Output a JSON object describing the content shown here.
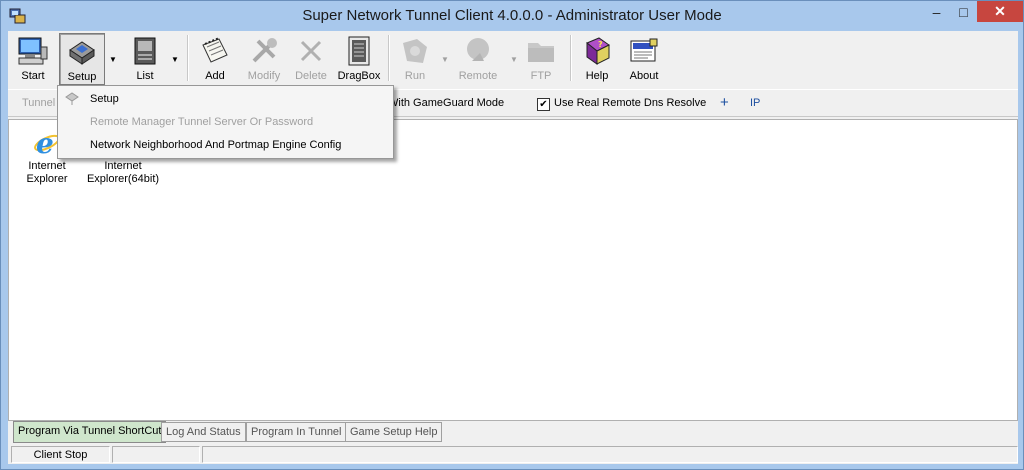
{
  "window": {
    "title": "Super Network Tunnel Client 4.0.0.0 - Administrator User Mode"
  },
  "toolbar": {
    "buttons": [
      {
        "label": "Start",
        "icon": "computer-icon",
        "enabled": true
      },
      {
        "label": "Setup",
        "icon": "setup-icon",
        "enabled": true,
        "pressed": true
      },
      {
        "label": "List",
        "icon": "list-icon",
        "enabled": true
      },
      {
        "label": "Add",
        "icon": "notepad-icon",
        "enabled": true
      },
      {
        "label": "Modify",
        "icon": "tools-icon",
        "enabled": false
      },
      {
        "label": "Delete",
        "icon": "delete-icon",
        "enabled": false
      },
      {
        "label": "DragBox",
        "icon": "dragbox-icon",
        "enabled": true
      },
      {
        "label": "Run",
        "icon": "run-icon",
        "enabled": false
      },
      {
        "label": "Remote",
        "icon": "remote-icon",
        "enabled": false
      },
      {
        "label": "FTP",
        "icon": "ftp-icon",
        "enabled": false
      },
      {
        "label": "Help",
        "icon": "help-book-icon",
        "enabled": true
      },
      {
        "label": "About",
        "icon": "about-icon",
        "enabled": true
      }
    ]
  },
  "options": {
    "tunnel_label": "Tunnel",
    "gameguard_label": "With GameGuard Mode",
    "dns_checked": true,
    "dns_label": "Use Real Remote Dns Resolve",
    "plus_label": "+",
    "ip_label": "IP"
  },
  "shortcuts": [
    {
      "label": "Internet Explorer",
      "icon": "internet-explorer-icon"
    },
    {
      "label": "Internet Explorer(64bit)",
      "icon": "internet-explorer-icon"
    }
  ],
  "menu": {
    "items": [
      {
        "label": "Setup",
        "enabled": true
      },
      {
        "label": "Remote Manager Tunnel Server Or Password",
        "enabled": false
      },
      {
        "label": "Network Neighborhood And Portmap Engine Config",
        "enabled": true
      }
    ]
  },
  "tabs": [
    {
      "label": "Program Via Tunnel ShortCut",
      "active": true
    },
    {
      "label": "Log And Status",
      "active": false
    },
    {
      "label": "Program In Tunnel",
      "active": false
    },
    {
      "label": "Game Setup Help",
      "active": false
    }
  ],
  "statusbar": {
    "status": "Client Stop",
    "cell2": "",
    "cell3": ""
  },
  "colors": {
    "titlebar": "#a8c8ec",
    "close_button": "#c7463f",
    "active_tab": "#cfe6cc",
    "link_blue": "#1d4fa0"
  }
}
